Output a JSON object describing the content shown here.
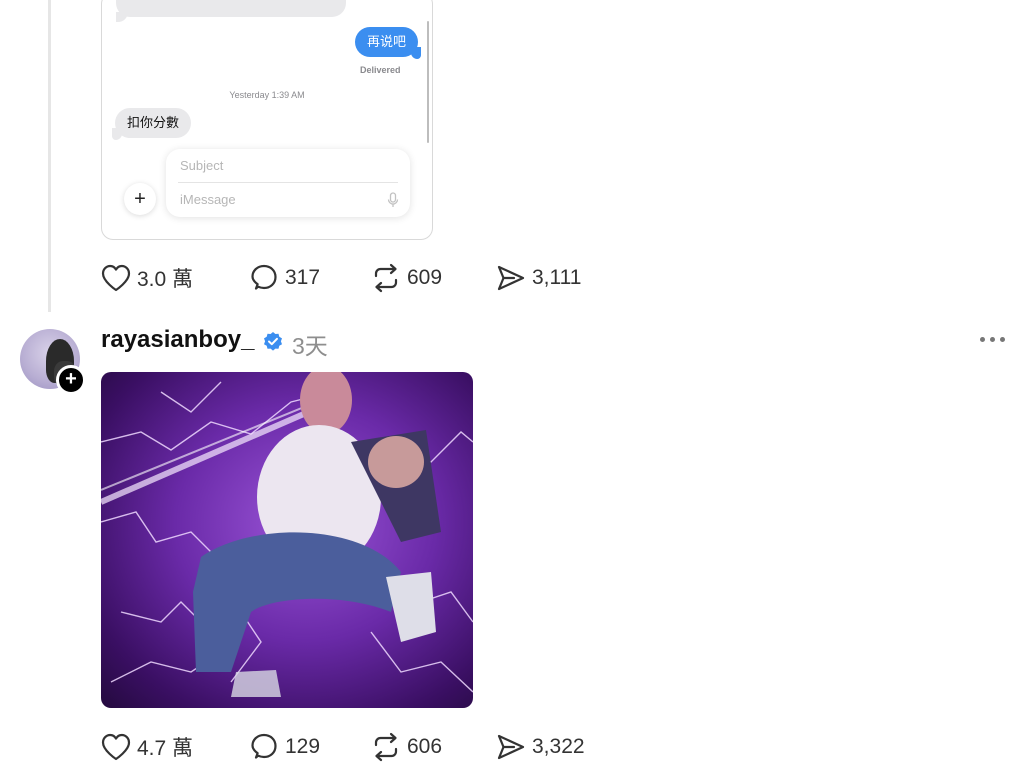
{
  "post1": {
    "screenshot": {
      "sent_message": "再说吧",
      "delivered_label": "Delivered",
      "timestamp": "Yesterday 1:39 AM",
      "received_message": "扣你分數",
      "subject_placeholder": "Subject",
      "message_placeholder": "iMessage",
      "plus_label": "+"
    },
    "actions": {
      "likes": "3.0 萬",
      "replies": "317",
      "reposts": "609",
      "shares": "3,111"
    }
  },
  "post2": {
    "username": "rayasianboy_",
    "time": "3天",
    "follow_label": "+",
    "actions": {
      "likes": "4.7 萬",
      "replies": "129",
      "reposts": "606",
      "shares": "3,322"
    }
  },
  "icons": {
    "like": "heart-icon",
    "reply": "comment-icon",
    "repost": "repost-icon",
    "share": "send-icon",
    "verified": "verified-badge-icon",
    "more": "more-icon"
  },
  "colors": {
    "imessage_blue": "#3b8ef0",
    "verified_blue": "#3b8ef0",
    "secondary_text": "#8e8e8e"
  }
}
